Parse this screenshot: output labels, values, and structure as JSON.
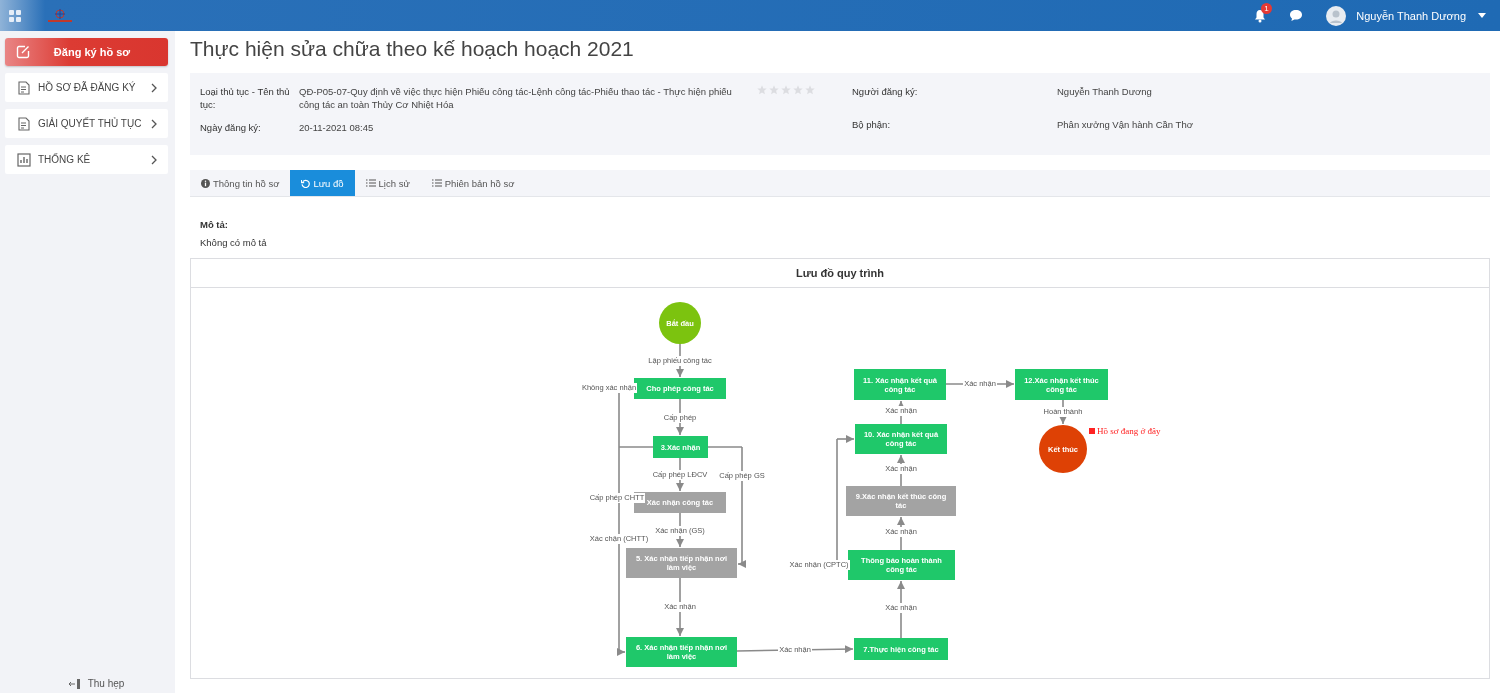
{
  "topbar": {
    "notification_count": "1",
    "user_name": "Nguyễn Thanh Dương"
  },
  "sidebar": {
    "items": [
      {
        "label": "Đăng ký hồ sơ",
        "kind": "primary"
      },
      {
        "label": "HỒ SƠ ĐÃ ĐĂNG KÝ",
        "kind": "registered"
      },
      {
        "label": "GIẢI QUYẾT THỦ TỤC",
        "kind": "process"
      },
      {
        "label": "THỐNG KÊ",
        "kind": "stats"
      }
    ],
    "collapse_label": "Thu hẹp"
  },
  "page_title": "Thực hiện sửa chữa theo kế hoạch hoạch 2021",
  "info": {
    "left": [
      {
        "label": "Loại thủ tục - Tên thủ tục:",
        "value": "QĐ-P05-07-Quy định về việc thực hiện Phiếu công tác-Lệnh công tác-Phiếu thao tác - Thực hiện phiếu công tác an toàn Thủy Cơ Nhiệt Hóa"
      },
      {
        "label": "Ngày đăng ký:",
        "value": "20-11-2021 08:45"
      }
    ],
    "stars": 0,
    "right": [
      {
        "label": "Người đăng ký:",
        "value": "Nguyễn Thanh Dương"
      },
      {
        "label": "Bộ phận:",
        "value": "Phân xưởng Vận hành Cần Thơ"
      }
    ]
  },
  "tabs": [
    {
      "label": "Thông tin hồ sơ",
      "kind": "info",
      "selected": false
    },
    {
      "label": "Lưu đồ",
      "kind": "flow",
      "selected": true
    },
    {
      "label": "Lịch sử",
      "kind": "list",
      "selected": false
    },
    {
      "label": "Phiên bản hồ sơ",
      "kind": "list",
      "selected": false
    }
  ],
  "description": {
    "label": "Mô tả:",
    "value": "Không có mô tả"
  },
  "flowchart": {
    "title": "Lưu đồ quy trình",
    "current_note": "Hồ sơ đang ở đây",
    "nodes": [
      {
        "lines": [
          "Bắt đầu"
        ],
        "kind": "start"
      },
      {
        "lines": [
          "Cho phép công tác"
        ],
        "kind": "step",
        "done": true
      },
      {
        "lines": [
          "3.Xác nhận"
        ],
        "kind": "step",
        "done": true
      },
      {
        "lines": [
          "Xác nhận công tác"
        ],
        "kind": "step",
        "done": false
      },
      {
        "lines": [
          "5. Xác nhận tiếp nhận nơi",
          "làm việc"
        ],
        "kind": "step",
        "done": false
      },
      {
        "lines": [
          "6. Xác nhận tiếp nhận nơi",
          "làm việc"
        ],
        "kind": "step",
        "done": true
      },
      {
        "lines": [
          "11. Xác nhận kết quả",
          "công tác"
        ],
        "kind": "step",
        "done": true
      },
      {
        "lines": [
          "10. Xác nhận kết quả",
          "công tác"
        ],
        "kind": "step",
        "done": true
      },
      {
        "lines": [
          "9.Xác nhận kết thúc công",
          "tác"
        ],
        "kind": "step",
        "done": false
      },
      {
        "lines": [
          "Thông báo hoàn thành",
          "công tác"
        ],
        "kind": "step",
        "done": true
      },
      {
        "lines": [
          "7.Thực hiện công tác"
        ],
        "kind": "step",
        "done": true
      },
      {
        "lines": [
          "12.Xác nhận kết thúc",
          "công tác"
        ],
        "kind": "step",
        "done": true
      },
      {
        "lines": [
          "Kết thúc"
        ],
        "kind": "end",
        "current": true
      }
    ],
    "edges": [
      {
        "label": "Lập phiếu công tác"
      },
      {
        "label": "Cấp phép"
      },
      {
        "label": "Cấp phép LĐCV"
      },
      {
        "label": "Cấp phép GS"
      },
      {
        "label": "Xác nhận (GS)"
      },
      {
        "label": "Xác nhận"
      },
      {
        "label": "Không xác nhận"
      },
      {
        "label": "Cấp phép CHTT"
      },
      {
        "label": "Xác chận (CHTT)"
      },
      {
        "label": "Xác nhận"
      },
      {
        "label": "Xác nhận"
      },
      {
        "label": "Xác nhận"
      },
      {
        "label": "Xác nhận"
      },
      {
        "label": "Xác nhận (CPTC)"
      },
      {
        "label": "Xác nhận"
      },
      {
        "label": "Xác nhận"
      },
      {
        "label": "Hoàn thành"
      }
    ]
  }
}
